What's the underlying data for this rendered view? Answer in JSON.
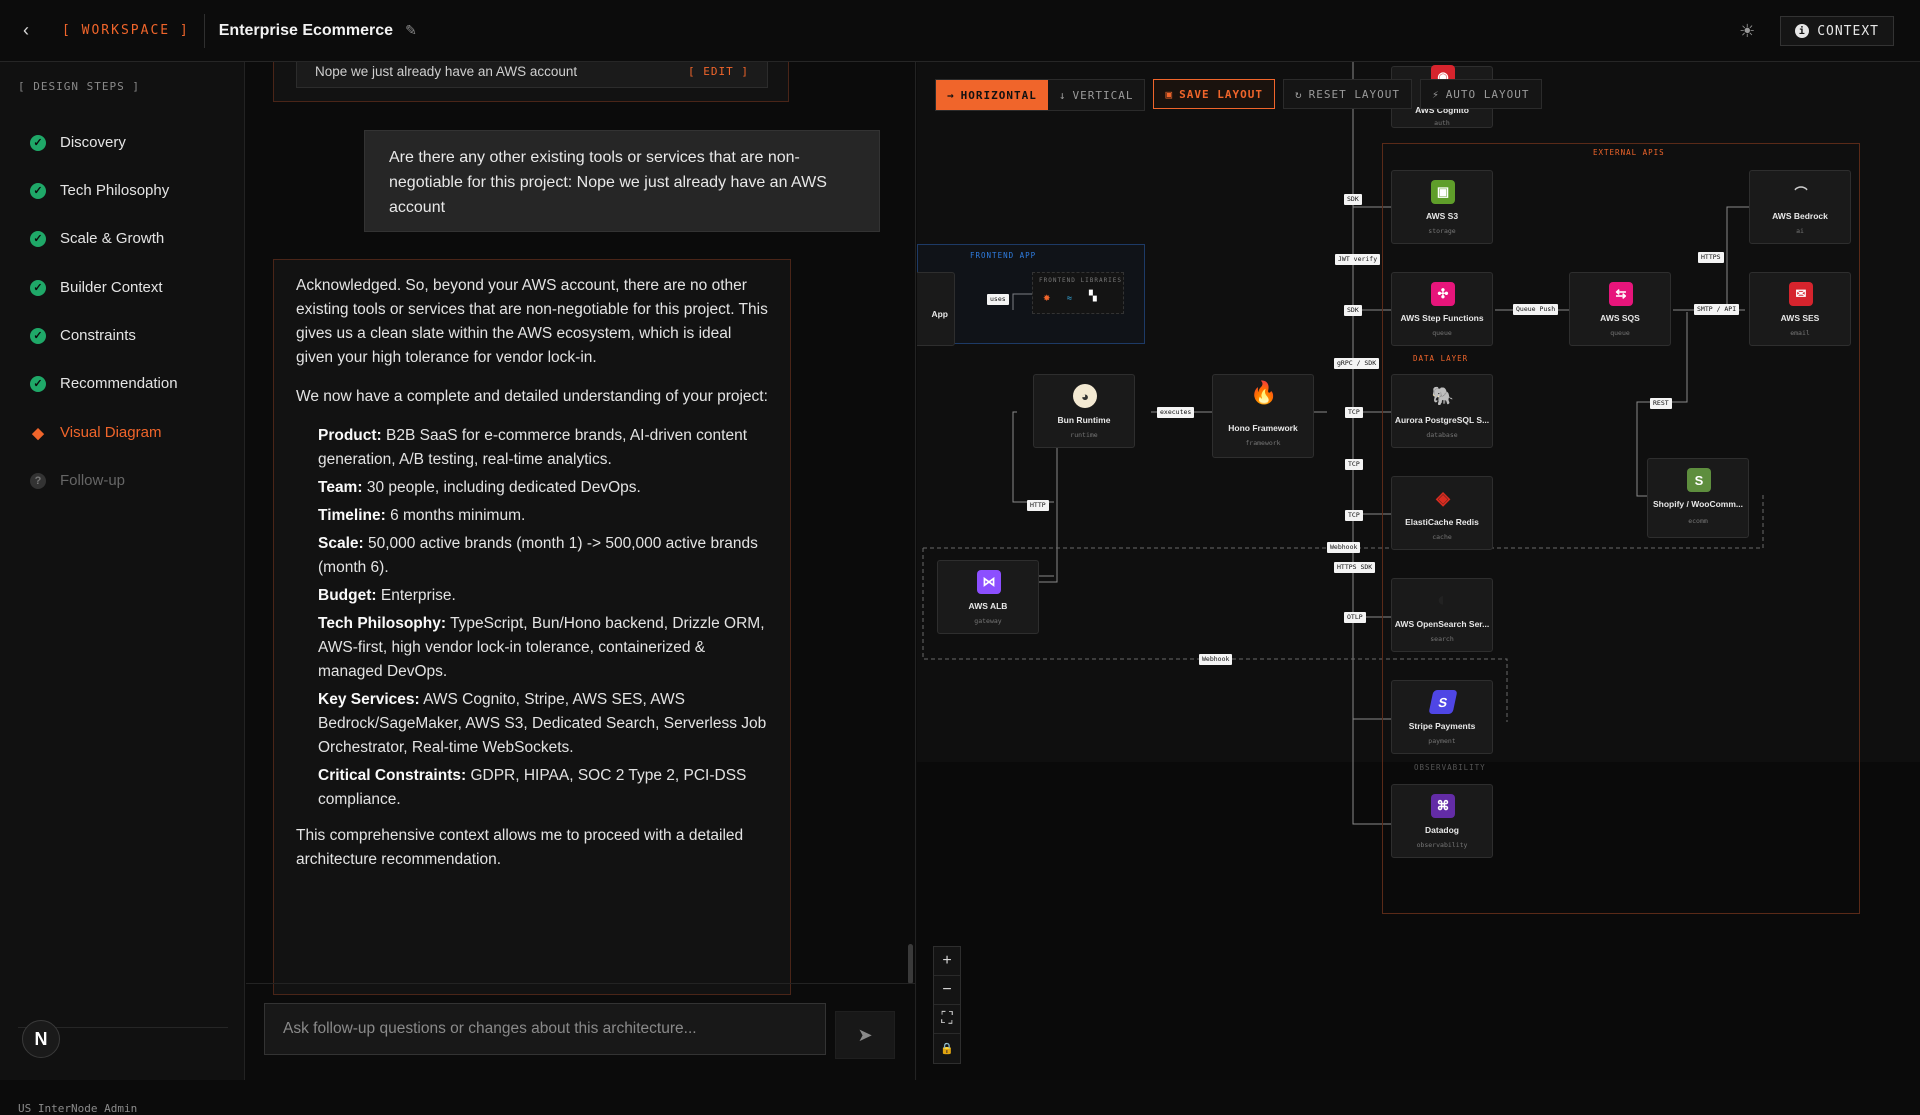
{
  "header": {
    "workspace_label": "[ WORKSPACE ]",
    "project_title": "Enterprise Ecommerce",
    "context_label": "CONTEXT"
  },
  "sidebar": {
    "section_label": "[ DESIGN STEPS ]",
    "steps": [
      {
        "label": "Discovery",
        "status": "done"
      },
      {
        "label": "Tech Philosophy",
        "status": "done"
      },
      {
        "label": "Scale & Growth",
        "status": "done"
      },
      {
        "label": "Builder Context",
        "status": "done"
      },
      {
        "label": "Constraints",
        "status": "done"
      },
      {
        "label": "Recommendation",
        "status": "done"
      },
      {
        "label": "Visual Diagram",
        "status": "active"
      },
      {
        "label": "Follow-up",
        "status": "pending"
      }
    ],
    "avatar_letter": "N",
    "user_line": "US InterNode Admin"
  },
  "chat": {
    "previous_answer": "Nope we just already have an AWS account",
    "edit_label": "[ EDIT ]",
    "user_message": "Are there any other existing tools or services that are non-negotiable for this project: Nope we just already have an AWS account",
    "ai_intro": "Acknowledged. So, beyond your AWS account, there are no other existing tools or services that are non-negotiable for this project. This gives us a clean slate within the AWS ecosystem, which is ideal given your high tolerance for vendor lock-in.",
    "ai_lead": "We now have a complete and detailed understanding of your project:",
    "ai_items": [
      {
        "k": "Product:",
        "v": "B2B SaaS for e-commerce brands, AI-driven content generation, A/B testing, real-time analytics."
      },
      {
        "k": "Team:",
        "v": "30 people, including dedicated DevOps."
      },
      {
        "k": "Timeline:",
        "v": "6 months minimum."
      },
      {
        "k": "Scale:",
        "v": "50,000 active brands (month 1) -> 500,000 active brands (month 6)."
      },
      {
        "k": "Budget:",
        "v": "Enterprise."
      },
      {
        "k": "Tech Philosophy:",
        "v": "TypeScript, Bun/Hono backend, Drizzle ORM, AWS-first, high vendor lock-in tolerance, containerized & managed DevOps."
      },
      {
        "k": "Key Services:",
        "v": "AWS Cognito, Stripe, AWS SES, AWS Bedrock/SageMaker, AWS S3, Dedicated Search, Serverless Job Orchestrator, Real-time WebSockets."
      },
      {
        "k": "Critical Constraints:",
        "v": "GDPR, HIPAA, SOC 2 Type 2, PCI-DSS compliance."
      }
    ],
    "ai_outro": "This comprehensive context allows me to proceed with a detailed architecture recommendation.",
    "input_placeholder": "Ask follow-up questions or changes about this architecture..."
  },
  "canvas": {
    "toolbar": {
      "horizontal": "HORIZONTAL",
      "vertical": "VERTICAL",
      "save": "SAVE LAYOUT",
      "reset": "RESET LAYOUT",
      "auto": "AUTO LAYOUT"
    },
    "groups": {
      "frontend": "FRONTEND APP",
      "frontend_libs": "FRONTEND LIBRARIES",
      "external": "EXTERNAL APIS",
      "data": "DATA LAYER",
      "observability": "OBSERVABILITY"
    },
    "nodes": {
      "cognito": {
        "title": "AWS Cognito",
        "sub": "auth"
      },
      "s3": {
        "title": "AWS S3",
        "sub": "storage"
      },
      "step_functions": {
        "title": "AWS Step Functions",
        "sub": "queue"
      },
      "sqs": {
        "title": "AWS SQS",
        "sub": "queue"
      },
      "bedrock": {
        "title": "AWS Bedrock",
        "sub": "ai"
      },
      "ses": {
        "title": "AWS SES",
        "sub": "email"
      },
      "app": {
        "title": "App",
        "sub": ""
      },
      "bun": {
        "title": "Bun Runtime",
        "sub": "runtime"
      },
      "hono": {
        "title": "Hono Framework",
        "sub": "framework"
      },
      "aurora": {
        "title": "Aurora PostgreSQL S...",
        "sub": "database"
      },
      "redis": {
        "title": "ElastiCache Redis",
        "sub": "cache"
      },
      "shopify": {
        "title": "Shopify / WooComm...",
        "sub": "ecomm"
      },
      "alb": {
        "title": "AWS ALB",
        "sub": "gateway"
      },
      "opensearch": {
        "title": "AWS OpenSearch Ser...",
        "sub": "search"
      },
      "stripe": {
        "title": "Stripe Payments",
        "sub": "payment"
      },
      "datadog": {
        "title": "Datadog",
        "sub": "observability"
      }
    },
    "edge_labels": {
      "sdk": "SDK",
      "jwt": "JWT verify",
      "sdk2": "SDK",
      "grpc": "gRPC / SDK",
      "queue_push": "Queue Push",
      "https": "HTTPS",
      "smtp": "SMTP / API",
      "rest": "REST",
      "uses": "uses",
      "executes": "executes",
      "http": "HTTP",
      "tcp1": "TCP",
      "tcp2": "TCP",
      "tcp3": "TCP",
      "webhook": "Webhook",
      "https_sdk": "HTTPS SDK",
      "otlp": "OTLP",
      "webhook2": "Webhook"
    },
    "zoom": {
      "in": "+",
      "out": "−",
      "fit": "⛶",
      "lock": "🔒"
    }
  },
  "colors": {
    "accent": "#f0652b",
    "success": "#1fa868",
    "frontend_blue": "#2f7de1"
  }
}
